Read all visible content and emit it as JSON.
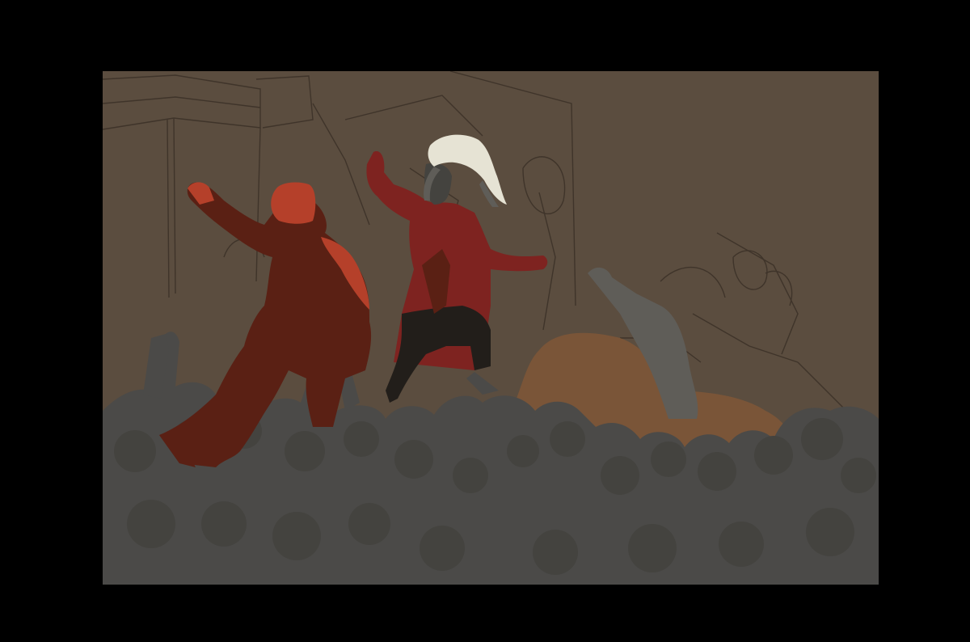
{
  "colors": {
    "frame": "#000000",
    "background": "#5b4d3f",
    "sketch_line": "#3f342a",
    "crowd": "#4b4a48",
    "crowd_dark": "#44433f",
    "brown_figure": "#7a5538",
    "red_light": "#b5402a",
    "red_dark": "#5a2014",
    "coat_red": "#7e2320",
    "trousers": "#221e1a",
    "hair": "#e6e3d4",
    "gray_figure": "#5f5d58"
  }
}
